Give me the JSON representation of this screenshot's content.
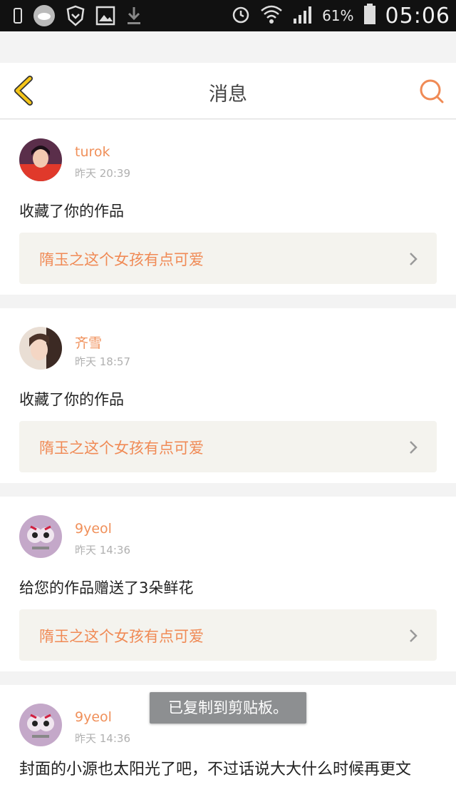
{
  "status_bar": {
    "battery_percent": "61%",
    "time": "05:06",
    "icons": [
      "sim-icon",
      "weather-icon",
      "shield-icon",
      "image-icon",
      "download-icon",
      "alarm-icon",
      "wifi-icon",
      "signal-icon",
      "battery-icon"
    ]
  },
  "header": {
    "title": "消息",
    "back_icon": "back-chevron-icon",
    "search_icon": "search-icon"
  },
  "messages": [
    {
      "username": "turok",
      "time": "昨天 20:39",
      "action": "收藏了你的作品",
      "work_title": "隋玉之这个女孩有点可爱"
    },
    {
      "username": "齐雪",
      "time": "昨天 18:57",
      "action": "收藏了你的作品",
      "work_title": "隋玉之这个女孩有点可爱"
    },
    {
      "username": "9yeol",
      "time": "昨天 14:36",
      "action": "给您的作品赠送了3朵鲜花",
      "work_title": "隋玉之这个女孩有点可爱"
    },
    {
      "username": "9yeol",
      "time": "昨天 14:36",
      "comment": "封面的小源也太阳光了吧，不过话说大大什么时候再更文"
    }
  ],
  "toast": "已复制到剪贴板。",
  "colors": {
    "accent": "#f08a55",
    "back_icon": "#f5c518",
    "link_background": "#f4f3ee"
  }
}
